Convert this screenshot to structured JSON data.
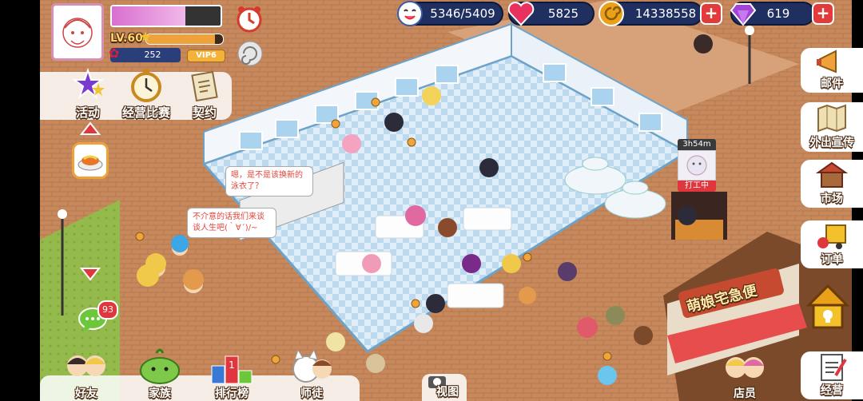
{
  "player": {
    "level": "LV.60",
    "roses": "252",
    "vip": "VIP6"
  },
  "resources": {
    "stamina": "5346/5409",
    "hearts": "5825",
    "gold": "14338558",
    "gems": "619"
  },
  "left_menu": {
    "activity": "活动",
    "contest": "经营比赛",
    "contract": "契约"
  },
  "right_menu": {
    "mail": "邮件",
    "promo": "外出宣传",
    "market": "市场",
    "orders": "订单",
    "manage": "经营"
  },
  "bottom_menu": {
    "friends": "好友",
    "family": "家族",
    "ranking": "排行榜",
    "mentor": "师徒",
    "view": "视图",
    "staff": "店员"
  },
  "chat_badge": "93",
  "timer": "3h54m",
  "work_label": "打工中",
  "bubbles": {
    "swimsuit": "嗯，是不是该换新的泳衣了？",
    "talk": "不介意的话我们来谈谈人生吧(｀∀´)/~"
  },
  "shop_sign": "萌娘宅急便",
  "colors": {
    "accent": "#e23b3b",
    "gem": "#a245d6",
    "heart": "#e8315e",
    "gold": "#e9a11a"
  }
}
